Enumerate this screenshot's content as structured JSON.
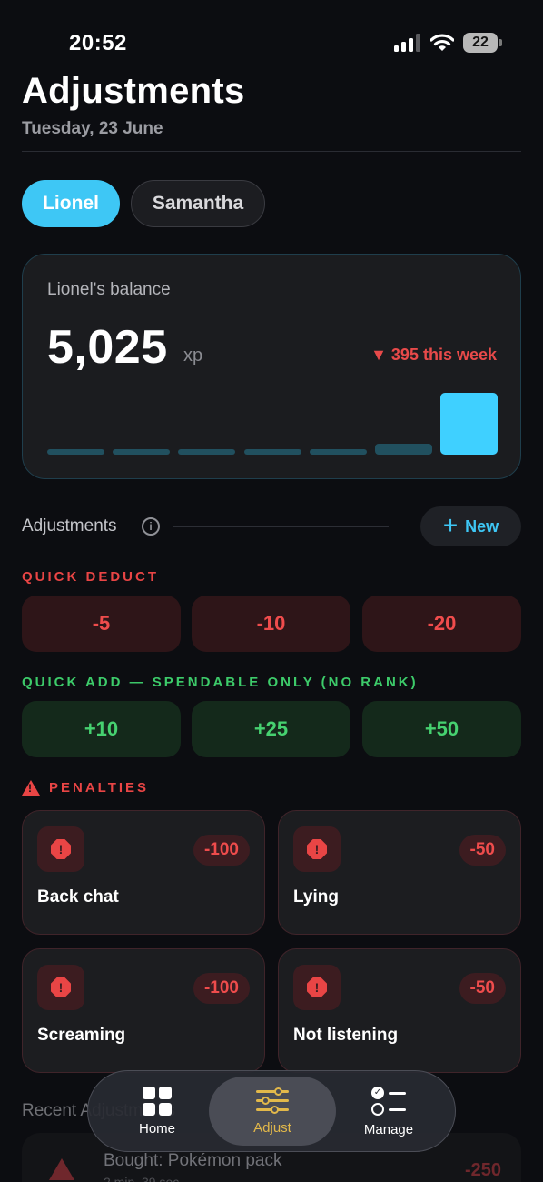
{
  "status": {
    "time": "20:52",
    "battery": "22"
  },
  "header": {
    "title": "Adjustments",
    "date": "Tuesday, 23 June"
  },
  "profiles": [
    {
      "name": "Lionel",
      "selected": true
    },
    {
      "name": "Samantha",
      "selected": false
    }
  ],
  "balance": {
    "label": "Lionel's balance",
    "value": "5,025",
    "unit": "xp",
    "change": "▼ 395 this week",
    "weekly_levels": [
      0.06,
      0.06,
      0.06,
      0.06,
      0.06,
      0.17,
      1.0
    ]
  },
  "adjustments": {
    "label": "Adjustments",
    "new_label": "New"
  },
  "quick_deduct": {
    "label": "QUICK DEDUCT",
    "buttons": [
      "-5",
      "-10",
      "-20"
    ]
  },
  "quick_add": {
    "label": "QUICK ADD — SPENDABLE ONLY (NO RANK)",
    "buttons": [
      "+10",
      "+25",
      "+50"
    ]
  },
  "penalties": {
    "label": "PENALTIES",
    "items": [
      {
        "name": "Back chat",
        "value": "-100"
      },
      {
        "name": "Lying",
        "value": "-50"
      },
      {
        "name": "Screaming",
        "value": "-100"
      },
      {
        "name": "Not listening",
        "value": "-50"
      }
    ]
  },
  "recent": {
    "label": "Recent Adjustments",
    "items": [
      {
        "title": "Bought: Pokémon pack",
        "time": "2 min, 39 sec",
        "value": "-250"
      }
    ]
  },
  "nav": {
    "items": [
      "Home",
      "Adjust",
      "Manage"
    ],
    "active": "Adjust"
  },
  "colors": {
    "accent": "#3ec7f5",
    "deduct": "#ef4c4c",
    "add": "#46d170",
    "nav_active": "#e2b84a"
  }
}
